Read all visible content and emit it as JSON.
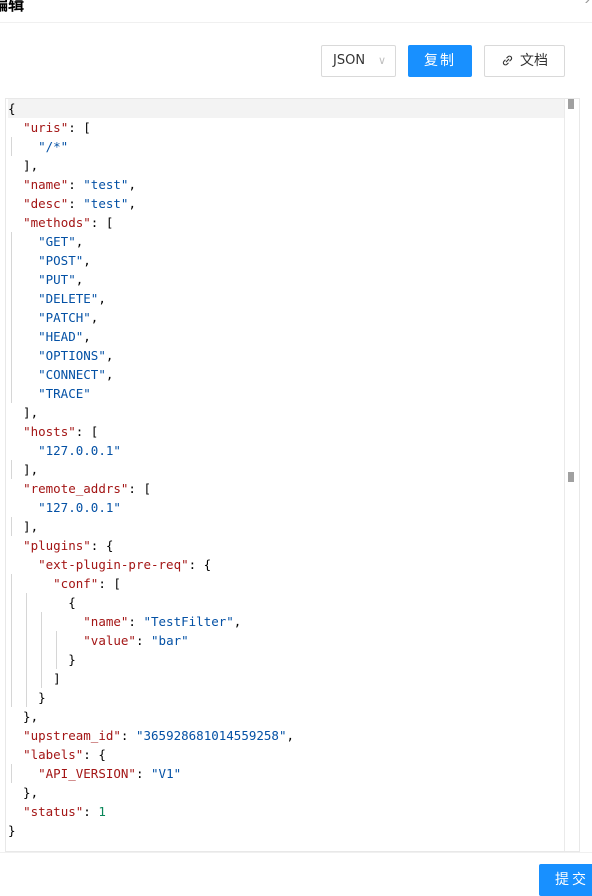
{
  "header": {
    "title": "编辑",
    "close_icon": "close-icon"
  },
  "toolbar": {
    "format_select": {
      "value": "JSON"
    },
    "copy_label": "复制",
    "doc_label": "文档",
    "doc_icon": "link-icon",
    "accent": "#1890ff"
  },
  "editor": {
    "lines": [
      [
        [
          "p",
          "{"
        ]
      ],
      [
        [
          "p",
          "  "
        ],
        [
          "k",
          "\"uris\""
        ],
        [
          "p",
          ": ["
        ]
      ],
      [
        [
          "p",
          "    "
        ],
        [
          "s",
          "\"/*\""
        ]
      ],
      [
        [
          "p",
          "  ],"
        ]
      ],
      [
        [
          "p",
          "  "
        ],
        [
          "k",
          "\"name\""
        ],
        [
          "p",
          ": "
        ],
        [
          "s",
          "\"test\""
        ],
        [
          "p",
          ","
        ]
      ],
      [
        [
          "p",
          "  "
        ],
        [
          "k",
          "\"desc\""
        ],
        [
          "p",
          ": "
        ],
        [
          "s",
          "\"test\""
        ],
        [
          "p",
          ","
        ]
      ],
      [
        [
          "p",
          "  "
        ],
        [
          "k",
          "\"methods\""
        ],
        [
          "p",
          ": ["
        ]
      ],
      [
        [
          "p",
          "    "
        ],
        [
          "s",
          "\"GET\""
        ],
        [
          "p",
          ","
        ]
      ],
      [
        [
          "p",
          "    "
        ],
        [
          "s",
          "\"POST\""
        ],
        [
          "p",
          ","
        ]
      ],
      [
        [
          "p",
          "    "
        ],
        [
          "s",
          "\"PUT\""
        ],
        [
          "p",
          ","
        ]
      ],
      [
        [
          "p",
          "    "
        ],
        [
          "s",
          "\"DELETE\""
        ],
        [
          "p",
          ","
        ]
      ],
      [
        [
          "p",
          "    "
        ],
        [
          "s",
          "\"PATCH\""
        ],
        [
          "p",
          ","
        ]
      ],
      [
        [
          "p",
          "    "
        ],
        [
          "s",
          "\"HEAD\""
        ],
        [
          "p",
          ","
        ]
      ],
      [
        [
          "p",
          "    "
        ],
        [
          "s",
          "\"OPTIONS\""
        ],
        [
          "p",
          ","
        ]
      ],
      [
        [
          "p",
          "    "
        ],
        [
          "s",
          "\"CONNECT\""
        ],
        [
          "p",
          ","
        ]
      ],
      [
        [
          "p",
          "    "
        ],
        [
          "s",
          "\"TRACE\""
        ]
      ],
      [
        [
          "p",
          "  ],"
        ]
      ],
      [
        [
          "p",
          "  "
        ],
        [
          "k",
          "\"hosts\""
        ],
        [
          "p",
          ": ["
        ]
      ],
      [
        [
          "p",
          "    "
        ],
        [
          "s",
          "\"127.0.0.1\""
        ]
      ],
      [
        [
          "p",
          "  ],"
        ]
      ],
      [
        [
          "p",
          "  "
        ],
        [
          "k",
          "\"remote_addrs\""
        ],
        [
          "p",
          ": ["
        ]
      ],
      [
        [
          "p",
          "    "
        ],
        [
          "s",
          "\"127.0.0.1\""
        ]
      ],
      [
        [
          "p",
          "  ],"
        ]
      ],
      [
        [
          "p",
          "  "
        ],
        [
          "k",
          "\"plugins\""
        ],
        [
          "p",
          ": {"
        ]
      ],
      [
        [
          "p",
          "    "
        ],
        [
          "k",
          "\"ext-plugin-pre-req\""
        ],
        [
          "p",
          ": {"
        ]
      ],
      [
        [
          "p",
          "      "
        ],
        [
          "k",
          "\"conf\""
        ],
        [
          "p",
          ": ["
        ]
      ],
      [
        [
          "p",
          "        {"
        ]
      ],
      [
        [
          "p",
          "          "
        ],
        [
          "k",
          "\"name\""
        ],
        [
          "p",
          ": "
        ],
        [
          "s",
          "\"TestFilter\""
        ],
        [
          "p",
          ","
        ]
      ],
      [
        [
          "p",
          "          "
        ],
        [
          "k",
          "\"value\""
        ],
        [
          "p",
          ": "
        ],
        [
          "s",
          "\"bar\""
        ]
      ],
      [
        [
          "p",
          "        }"
        ]
      ],
      [
        [
          "p",
          "      ]"
        ]
      ],
      [
        [
          "p",
          "    }"
        ]
      ],
      [
        [
          "p",
          "  },"
        ]
      ],
      [
        [
          "p",
          "  "
        ],
        [
          "k",
          "\"upstream_id\""
        ],
        [
          "p",
          ": "
        ],
        [
          "s",
          "\"365928681014559258\""
        ],
        [
          "p",
          ","
        ]
      ],
      [
        [
          "p",
          "  "
        ],
        [
          "k",
          "\"labels\""
        ],
        [
          "p",
          ": {"
        ]
      ],
      [
        [
          "p",
          "    "
        ],
        [
          "k",
          "\"API_VERSION\""
        ],
        [
          "p",
          ": "
        ],
        [
          "s",
          "\"V1\""
        ]
      ],
      [
        [
          "p",
          "  },"
        ]
      ],
      [
        [
          "p",
          "  "
        ],
        [
          "k",
          "\"status\""
        ],
        [
          "p",
          ": "
        ],
        [
          "n",
          "1"
        ]
      ],
      [
        [
          "p",
          "}"
        ]
      ]
    ]
  },
  "footer": {
    "submit_label": "提交"
  }
}
